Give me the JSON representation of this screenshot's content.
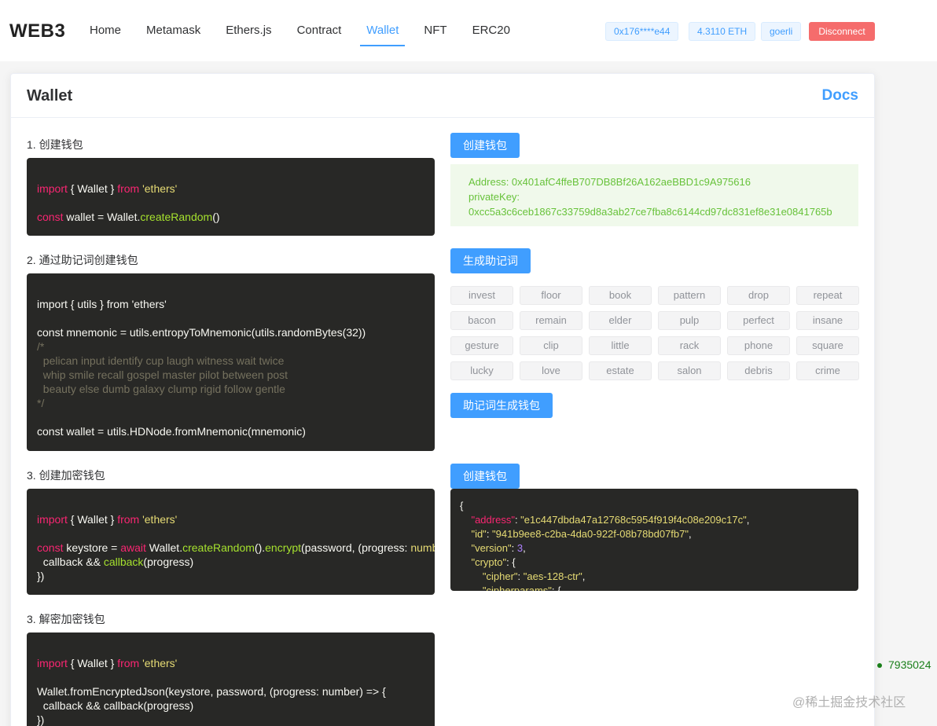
{
  "brand": "WEB3",
  "nav": [
    {
      "label": "Home"
    },
    {
      "label": "Metamask"
    },
    {
      "label": "Ethers.js"
    },
    {
      "label": "Contract"
    },
    {
      "label": "Wallet"
    },
    {
      "label": "NFT"
    },
    {
      "label": "ERC20"
    }
  ],
  "active_nav": "Wallet",
  "status": {
    "account": "0x176****e44",
    "balance": "4.3110 ETH",
    "network": "goerli",
    "disconnect_label": "Disconnect"
  },
  "card": {
    "title": "Wallet",
    "docs_label": "Docs"
  },
  "sections": [
    {
      "label": "1. 创建钱包"
    },
    {
      "label": "2. 通过助记词创建钱包"
    },
    {
      "label": "3. 创建加密钱包"
    },
    {
      "label": "3. 解密加密钱包"
    }
  ],
  "code1": {
    "l1_kw": "import",
    "l1_mid": " { Wallet } ",
    "l1_kw2": "from",
    "l1_sp": " ",
    "l1_str": "'ethers'",
    "l2_kw": "const",
    "l2_mid": " wallet = Wallet.",
    "l2_fn": "createRandom",
    "l2_end": "()"
  },
  "code2": {
    "l1": "import { utils } from 'ethers'",
    "l2": "const mnemonic = utils.entropyToMnemonic(utils.randomBytes(32))",
    "c1": "/*",
    "c2": "  pelican input identify cup laugh witness wait twice",
    "c3": "  whip smile recall gospel master pilot between post",
    "c4": "  beauty else dumb galaxy clump rigid follow gentle",
    "c5": "*/",
    "l3": "const wallet = utils.HDNode.fromMnemonic(mnemonic)"
  },
  "code3": {
    "l1_kw": "import",
    "l1_mid": " { Wallet } ",
    "l1_kw2": "from",
    "l1_sp": " ",
    "l1_str": "'ethers'",
    "l2_kw": "const",
    "l2_a": " keystore = ",
    "l2_kw2": "await",
    "l2_b": " Wallet.",
    "l2_fn": "createRandom",
    "l2_c": "().",
    "l2_fn2": "encrypt",
    "l2_d": "(password, (progress: ",
    "l2_e": "number",
    "l3_a": "  callback && ",
    "l3_fn": "callback",
    "l3_b": "(progress)",
    "l4": "})"
  },
  "code4": {
    "l1_kw": "import",
    "l1_mid": " { Wallet } ",
    "l1_kw2": "from",
    "l1_sp": " ",
    "l1_str": "'ethers'",
    "l2": "Wallet.fromEncryptedJson(keystore, password, (progress: number) => {",
    "l3": "  callback && callback(progress)",
    "l4": "})"
  },
  "create_wallet_button": "创建钱包",
  "wallet_result": {
    "address": "Address: 0x401afC4ffeB707DB8Bf26A162aeBBD1c9A975616",
    "private_key_label": "privateKey:",
    "private_key": "0xcc5a3c6ceb1867c33759d8a3ab27ce7fba8c6144cd97dc831ef8e31e0841765b"
  },
  "generate_mnemonic_button": "生成助记词",
  "mnemonic_words": [
    "invest",
    "floor",
    "book",
    "pattern",
    "drop",
    "repeat",
    "bacon",
    "remain",
    "elder",
    "pulp",
    "perfect",
    "insane",
    "gesture",
    "clip",
    "little",
    "rack",
    "phone",
    "square",
    "lucky",
    "love",
    "estate",
    "salon",
    "debris",
    "crime"
  ],
  "mnemonic_wallet_button": "助记词生成钱包",
  "encrypt_wallet_button": "创建钱包",
  "keystore": {
    "open": "{",
    "address_key": "\"address\"",
    "address_val": "\"e1c447dbda47a12768c5954f919f4c08e209c17c\"",
    "id_key": "\"id\"",
    "id_val": "\"941b9ee8-c2ba-4da0-922f-08b78bd07fb7\"",
    "version_key": "\"version\"",
    "version_val": "3",
    "crypto_key": "\"crypto\"",
    "cipher_key": "\"cipher\"",
    "cipher_val": "\"aes-128-ctr\"",
    "cipherparams_key": "\"cipherparams\""
  },
  "side_number": "7935024",
  "watermark": "@稀土掘金技术社区",
  "colors": {
    "primary": "#409eff",
    "danger": "#f56c6c",
    "success_text": "#67c23a",
    "code_bg": "#282826"
  }
}
